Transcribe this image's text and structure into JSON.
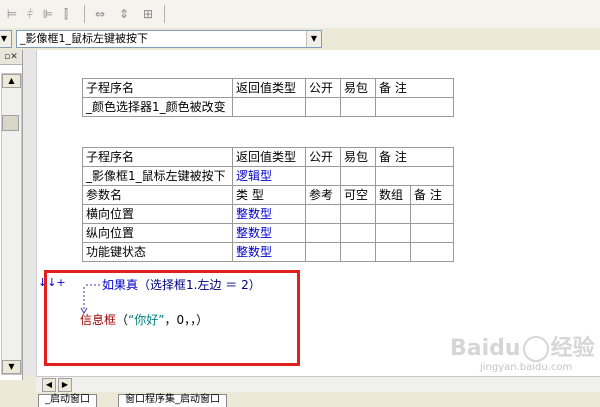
{
  "toolbar": {
    "buttons": [
      "align-left-icon",
      "align-center-icon",
      "align-right-icon",
      "distribute-h-icon",
      "distribute-v-icon",
      "same-width-icon",
      "same-height-icon",
      "same-size-icon"
    ]
  },
  "combos": {
    "left": {
      "value": ""
    },
    "event": {
      "value": "_影像框1_鼠标左键被按下"
    }
  },
  "table1": {
    "headers": [
      "子程序名",
      "返回值类型",
      "公开",
      "易包",
      "备 注"
    ],
    "row": [
      "_颜色选择器1_颜色被改变",
      "",
      "",
      "",
      ""
    ]
  },
  "table2": {
    "headers": [
      "子程序名",
      "返回值类型",
      "公开",
      "易包",
      "备 注"
    ],
    "row": [
      "_影像框1_鼠标左键被按下",
      "逻辑型",
      "",
      "",
      ""
    ],
    "param_headers": [
      "参数名",
      "类 型",
      "参考",
      "可空",
      "数组",
      "备 注"
    ],
    "params": [
      [
        "横向位置",
        "整数型"
      ],
      [
        "纵向位置",
        "整数型"
      ],
      [
        "功能键状态",
        "整数型"
      ]
    ]
  },
  "code": {
    "gutter_symbols": "↓↓+",
    "line1_keyword": "如果真",
    "line1_rest": "（选择框1.左边 ＝ 2）",
    "line2_func": "信息框",
    "line2_open": "（",
    "line2_string": "“你好”",
    "line2_rest": "，0，，）"
  },
  "tabs": [
    "_启动窗口",
    "窗口程序集_启动窗口"
  ],
  "watermark": {
    "brand": "Baidu",
    "cn": "经验",
    "url": "jingyan.baidu.com"
  },
  "colors": {
    "highlight_border": "#e0201c",
    "type_blue": "#0000cc",
    "keyword_blue": "#0000cc",
    "func_red": "#990000"
  }
}
